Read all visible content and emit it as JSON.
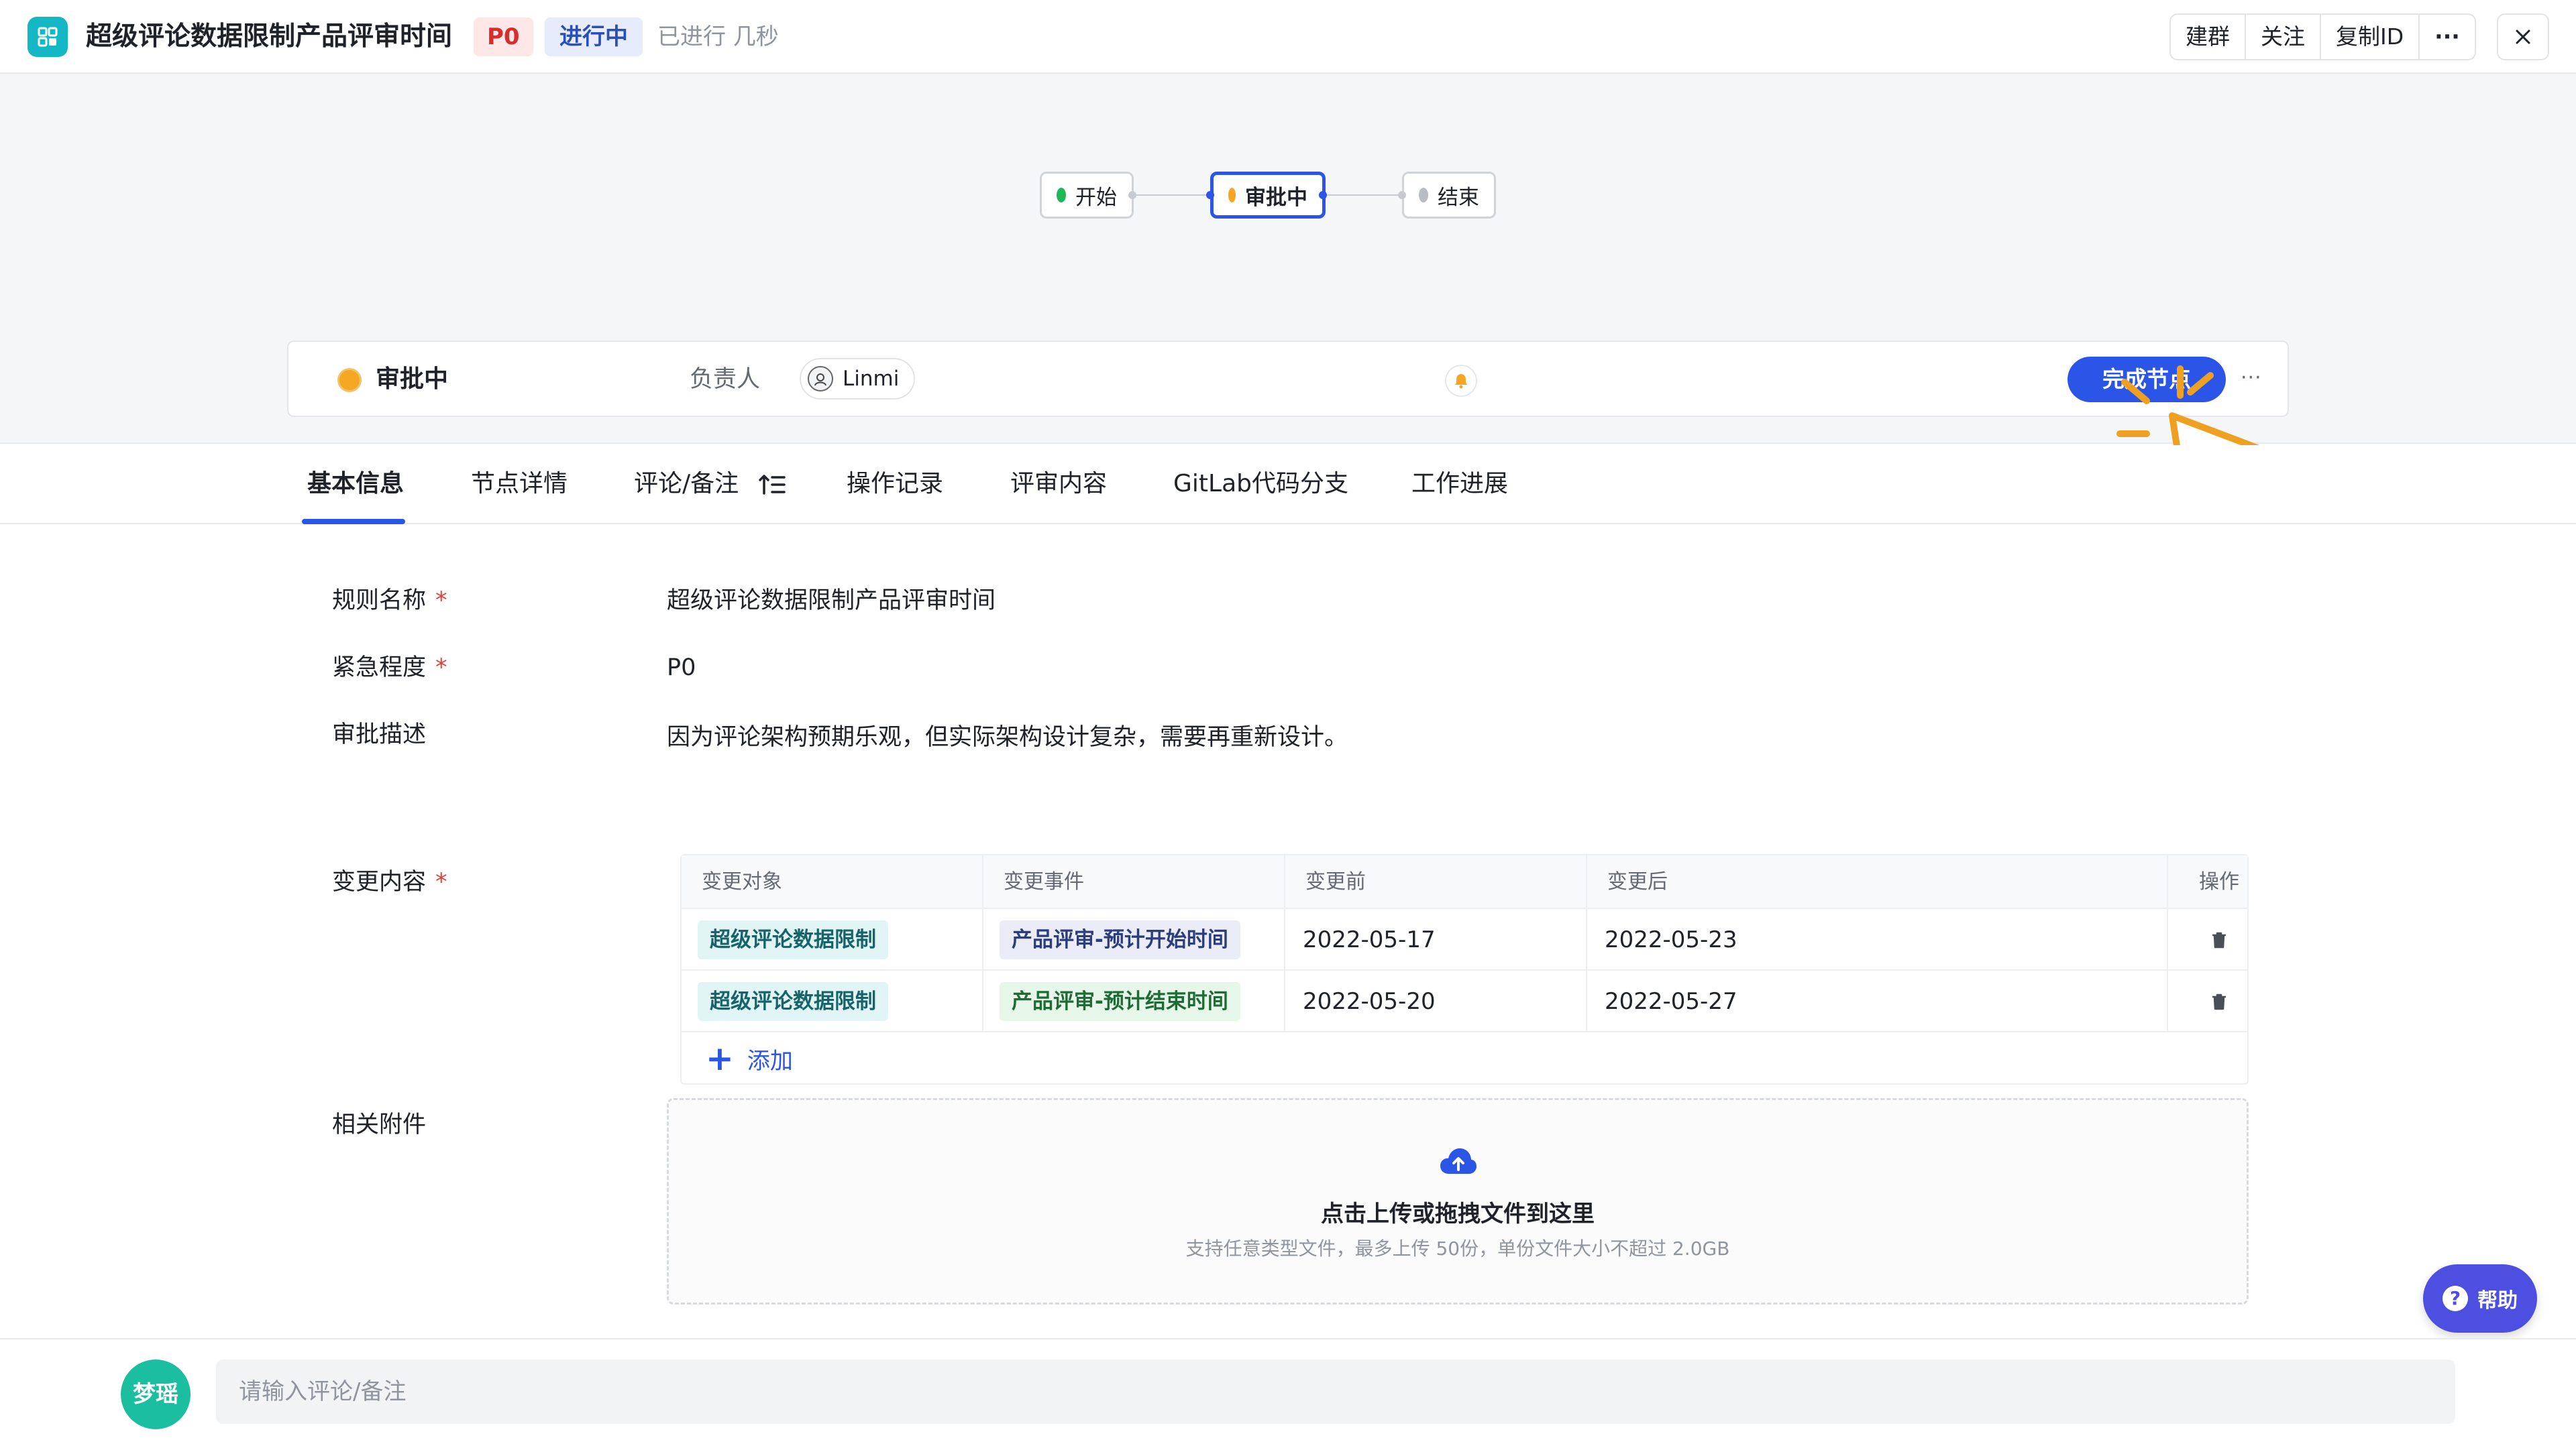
{
  "header": {
    "title": "超级评论数据限制产品评审时间",
    "priority": "P0",
    "status": "进行中",
    "elapsed": "已进行 几秒",
    "actions": {
      "group": "建群",
      "follow": "关注",
      "copy_id": "复制ID",
      "more": "···"
    },
    "accent_color": "#14b8c4"
  },
  "flow": {
    "nodes": [
      {
        "label": "开始",
        "color": "#1db85a"
      },
      {
        "label": "审批中",
        "color": "#f5a623"
      },
      {
        "label": "结束",
        "color": "#b8bcc3"
      }
    ]
  },
  "node_card": {
    "status": "审批中",
    "owner_label": "负责人",
    "owner_name": "Linmi",
    "complete_label": "完成节点",
    "more": "···"
  },
  "tabs": [
    {
      "label": "基本信息",
      "active": true
    },
    {
      "label": "节点详情"
    },
    {
      "label": "评论/备注"
    },
    {
      "label": "操作记录"
    },
    {
      "label": "评审内容"
    },
    {
      "label": "GitLab代码分支"
    },
    {
      "label": "工作进展"
    }
  ],
  "form": {
    "rule_name": {
      "label": "规则名称",
      "value": "超级评论数据限制产品评审时间"
    },
    "urgency": {
      "label": "紧急程度",
      "value": "P0"
    },
    "description": {
      "label": "审批描述",
      "value": "因为评论架构预期乐观，但实际架构设计复杂，需要再重新设计。"
    },
    "changes_label": "变更内容",
    "attachments_label": "相关附件",
    "required_mark": "*"
  },
  "change_table": {
    "headers": [
      "变更对象",
      "变更事件",
      "变更前",
      "变更后",
      "操作"
    ],
    "rows": [
      {
        "object": "超级评论数据限制",
        "event": "产品评审-预计开始时间",
        "before": "2022-05-17",
        "after": "2022-05-23"
      },
      {
        "object": "超级评论数据限制",
        "event": "产品评审-预计结束时间",
        "before": "2022-05-20",
        "after": "2022-05-27"
      }
    ],
    "add_label": "添加"
  },
  "upload": {
    "title": "点击上传或拖拽文件到这里",
    "subtitle": "支持任意类型文件，最多上传 50份，单份文件大小不超过 2.0GB"
  },
  "help": {
    "label": "帮助",
    "icon_glyph": "?"
  },
  "comment": {
    "avatar_text": "梦瑶",
    "placeholder": "请输入评论/备注"
  }
}
